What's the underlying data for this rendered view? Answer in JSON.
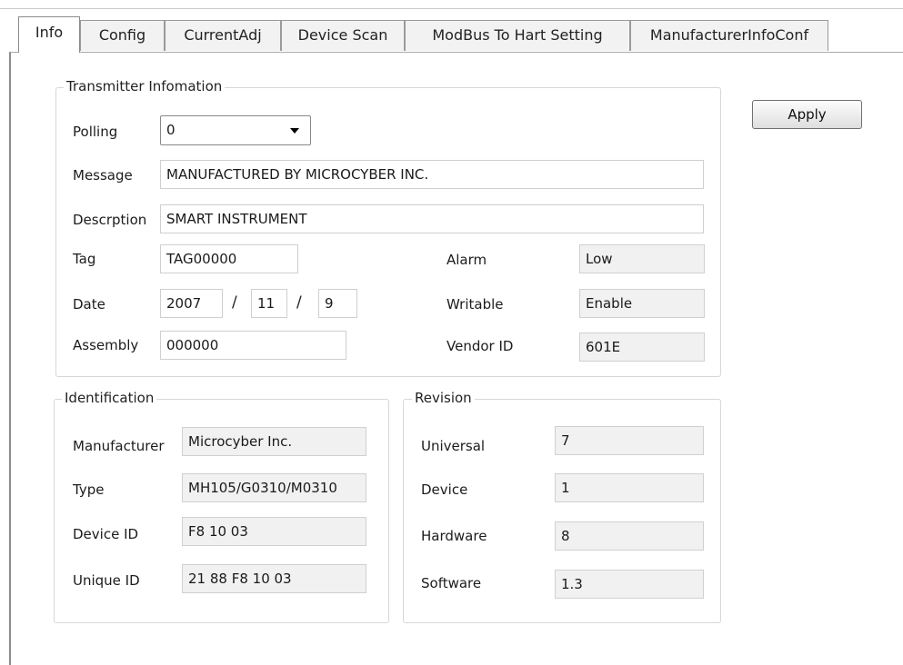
{
  "tabs": [
    "Info",
    "Config",
    "CurrentAdj",
    "Device Scan",
    "ModBus To Hart Setting",
    "ManufacturerInfoConf"
  ],
  "active_tab": "Info",
  "apply_button": "Apply",
  "transmitter": {
    "title": "Transmitter Infomation",
    "polling_label": "Polling",
    "polling_value": "0",
    "message_label": "Message",
    "message_value": "MANUFACTURED BY MICROCYBER INC.",
    "description_label": "Descrption",
    "description_value": "SMART INSTRUMENT",
    "tag_label": "Tag",
    "tag_value": "TAG00000",
    "date_label": "Date",
    "date_year": "2007",
    "date_month": "11",
    "date_day": "9",
    "date_separator": "/",
    "assembly_label": "Assembly",
    "assembly_value": "000000",
    "alarm_label": "Alarm",
    "alarm_value": "Low",
    "writable_label": "Writable",
    "writable_value": "Enable",
    "vendor_label": "Vendor ID",
    "vendor_value": "601E"
  },
  "identification": {
    "title": "Identification",
    "manufacturer_label": "Manufacturer",
    "manufacturer_value": "Microcyber Inc.",
    "type_label": "Type",
    "type_value": "MH105/G0310/M0310",
    "device_id_label": "Device ID",
    "device_id_value": "F8 10 03",
    "unique_id_label": "Unique ID",
    "unique_id_value": "21 88 F8 10 03"
  },
  "revision": {
    "title": "Revision",
    "universal_label": "Universal",
    "universal_value": "7",
    "device_label": "Device",
    "device_value": "1",
    "hardware_label": "Hardware",
    "hardware_value": "8",
    "software_label": "Software",
    "software_value": "1.3"
  }
}
